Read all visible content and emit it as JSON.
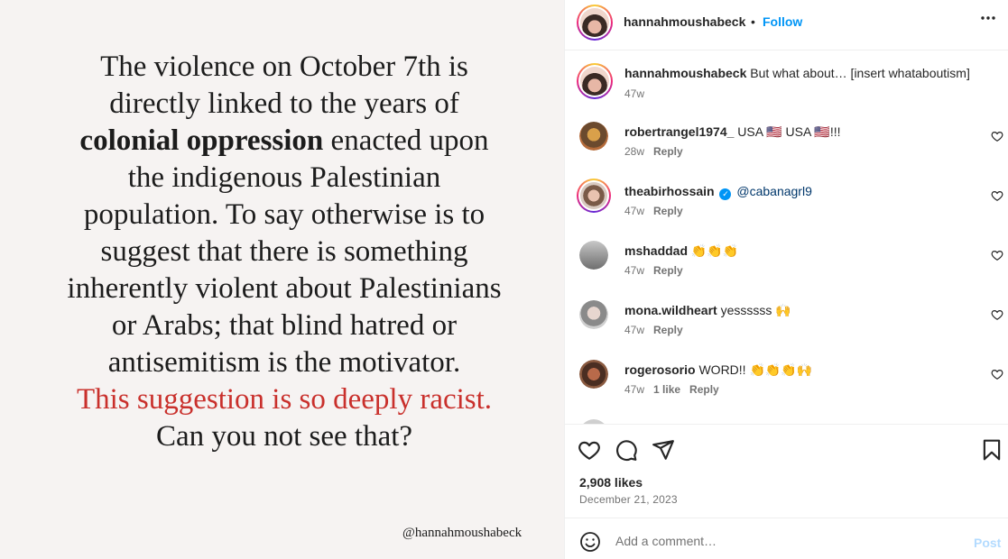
{
  "post_image": {
    "quote": {
      "l1": "The violence on October 7th is",
      "l2": "directly linked to the years of",
      "l3_bold": "colonial oppression",
      "l3_rest": " enacted upon",
      "l4": "the indigenous Palestinian",
      "l5": "population. To say otherwise is to",
      "l6": "suggest that there is something",
      "l7": "inherently violent about Palestinians",
      "l8": "or Arabs; that blind hatred or",
      "l9": "antisemitism is the motivator.",
      "l10_red": "This suggestion is so deeply racist.",
      "l11": "Can you not see that?"
    },
    "handle": "@hannahmoushabeck",
    "colors": {
      "background": "#f6f3f2",
      "highlight": "#c9302c"
    }
  },
  "header": {
    "username": "hannahmoushabeck",
    "separator": "•",
    "follow_label": "Follow",
    "more_icon": "ellipsis-icon"
  },
  "caption": {
    "username": "hannahmoushabeck",
    "text": "But what about… [insert whataboutism]",
    "time": "47w"
  },
  "comments": [
    {
      "username": "robertrangel1974_",
      "text": "USA 🇺🇸 USA 🇺🇸!!!",
      "time": "28w",
      "reply": "Reply"
    },
    {
      "username": "theabirhossain",
      "verified": true,
      "text": "@cabanagrl9",
      "time": "47w",
      "reply": "Reply"
    },
    {
      "username": "mshaddad",
      "text": "👏👏👏",
      "time": "47w",
      "reply": "Reply"
    },
    {
      "username": "mona.wildheart",
      "text": "yessssss 🙌",
      "time": "47w",
      "reply": "Reply"
    },
    {
      "username": "rogerosorio",
      "text": "WORD!! 👏👏👏🙌",
      "time": "47w",
      "likes": "1 like",
      "reply": "Reply"
    }
  ],
  "actions": {
    "icons": [
      "heart-icon",
      "comment-icon",
      "share-icon",
      "bookmark-icon"
    ],
    "likes": "2,908 likes",
    "date": "December 21, 2023"
  },
  "add_comment": {
    "placeholder": "Add a comment…",
    "post_label": "Post"
  },
  "colors": {
    "accent": "#0095f6",
    "text": "#262626",
    "muted": "#737373"
  }
}
